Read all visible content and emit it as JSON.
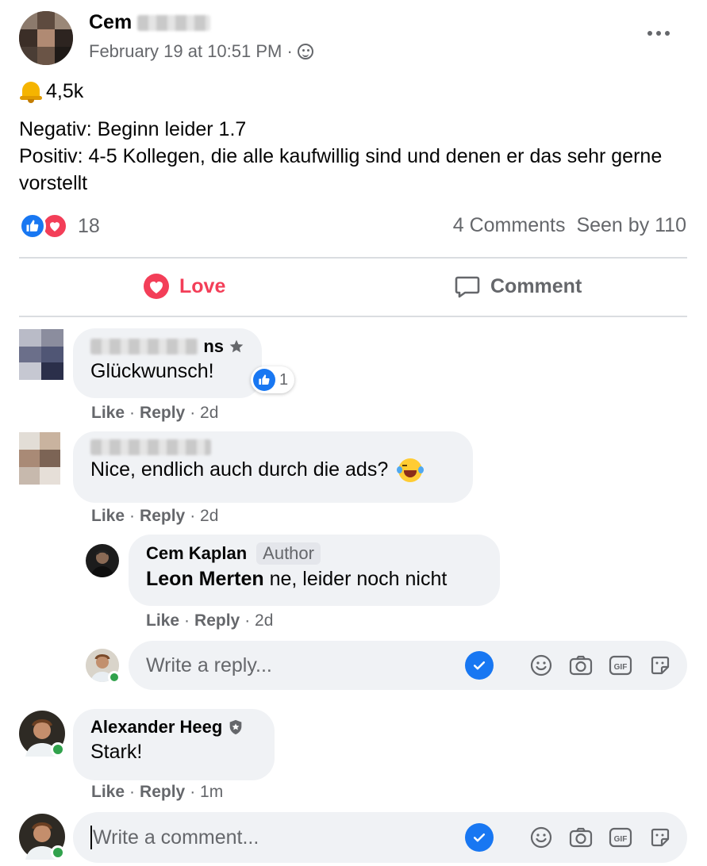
{
  "post": {
    "author_visible": "Cem",
    "date": "February 19 at 10:51 PM ·",
    "bell_text": "4,5k",
    "line1": "Negativ: Beginn leider 1.7",
    "line2": "Positiv: 4-5 Kollegen, die alle kaufwillig sind und denen er das sehr gerne vorstellt",
    "reaction_count": "18",
    "comments_count": "4 Comments",
    "seen_by": "Seen by 110"
  },
  "actions": {
    "love": "Love",
    "comment": "Comment"
  },
  "comments": [
    {
      "name_suffix": "ns",
      "text": "Glückwunsch!",
      "likes": "1",
      "like": "Like",
      "reply": "Reply",
      "time": "· 2d"
    },
    {
      "text": "Nice, endlich auch durch die ads?",
      "like": "Like",
      "reply": "Reply",
      "time": "· 2d"
    },
    {
      "name": "Cem Kaplan",
      "badge": "Author",
      "mention": "Leon Merten",
      "text": " ne, leider noch nicht",
      "like": "Like",
      "reply": "Reply",
      "time": "· 2d"
    },
    {
      "name": "Alexander Heeg",
      "text": "Stark!",
      "like": "Like",
      "reply": "Reply",
      "time": "· 1m"
    }
  ],
  "reply_input": {
    "placeholder": "Write a reply..."
  },
  "comment_input": {
    "placeholder": "Write a comment..."
  },
  "colors": {
    "blue": "#1877f2",
    "love": "#f33e58",
    "grey": "#65676b",
    "bubble": "#f0f2f5"
  },
  "icons": [
    "globe-icon",
    "more-icon",
    "bell-icon",
    "like-icon",
    "love-icon",
    "comment-icon",
    "star-icon",
    "shield-icon",
    "check-icon",
    "emoji-icon",
    "camera-icon",
    "gif-icon",
    "sticker-icon",
    "laughing-emoji-icon"
  ]
}
